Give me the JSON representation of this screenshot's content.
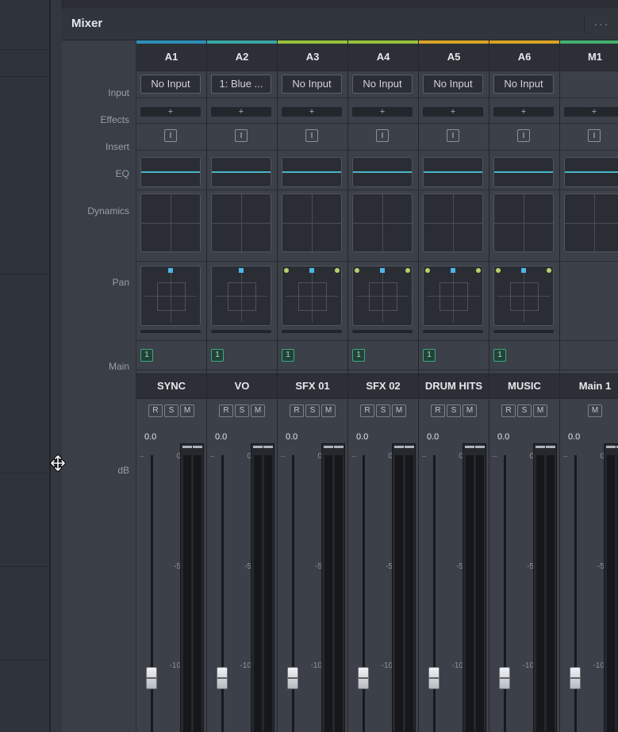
{
  "mixer": {
    "title": "Mixer",
    "more_label": "···"
  },
  "row_labels": {
    "input": "Input",
    "effects": "Effects",
    "insert": "Insert",
    "eq": "EQ",
    "dynamics": "Dynamics",
    "pan": "Pan",
    "main": "Main",
    "db": "dB"
  },
  "strips": [
    {
      "id": "A1",
      "input": "No Input",
      "effects": "+",
      "insert": "I",
      "main": "1",
      "name": "SYNC",
      "buttons": [
        "R",
        "S",
        "M"
      ],
      "db": "0.0",
      "color": "#2e8fb8",
      "pan": "mono"
    },
    {
      "id": "A2",
      "input": "1: Blue ...",
      "effects": "+",
      "insert": "I",
      "main": "1",
      "name": "VO",
      "buttons": [
        "R",
        "S",
        "M"
      ],
      "db": "0.0",
      "color": "#3aa7a4",
      "pan": "mono"
    },
    {
      "id": "A3",
      "input": "No Input",
      "effects": "+",
      "insert": "I",
      "main": "1",
      "name": "SFX 01",
      "buttons": [
        "R",
        "S",
        "M"
      ],
      "db": "0.0",
      "color": "#96c33c",
      "pan": "stereo"
    },
    {
      "id": "A4",
      "input": "No Input",
      "effects": "+",
      "insert": "I",
      "main": "1",
      "name": "SFX 02",
      "buttons": [
        "R",
        "S",
        "M"
      ],
      "db": "0.0",
      "color": "#96c33c",
      "pan": "stereo"
    },
    {
      "id": "A5",
      "input": "No Input",
      "effects": "+",
      "insert": "I",
      "main": "1",
      "name": "DRUM HITS",
      "buttons": [
        "R",
        "S",
        "M"
      ],
      "db": "0.0",
      "color": "#d9a326",
      "pan": "stereo"
    },
    {
      "id": "A6",
      "input": "No Input",
      "effects": "+",
      "insert": "I",
      "main": "1",
      "name": "MUSIC",
      "buttons": [
        "R",
        "S",
        "M"
      ],
      "db": "0.0",
      "color": "#d9a326",
      "pan": "stereo"
    },
    {
      "id": "M1",
      "input": "",
      "effects": "+",
      "insert": "I",
      "main": "",
      "name": "Main 1",
      "buttons": [
        "M"
      ],
      "db": "0.0",
      "color": "#43b070",
      "pan": "none"
    }
  ],
  "scale": {
    "zero": "0",
    "minus5": "-5",
    "minus10": "-10"
  },
  "icons": {
    "cursor": "resize-horizontal-cursor-icon"
  }
}
